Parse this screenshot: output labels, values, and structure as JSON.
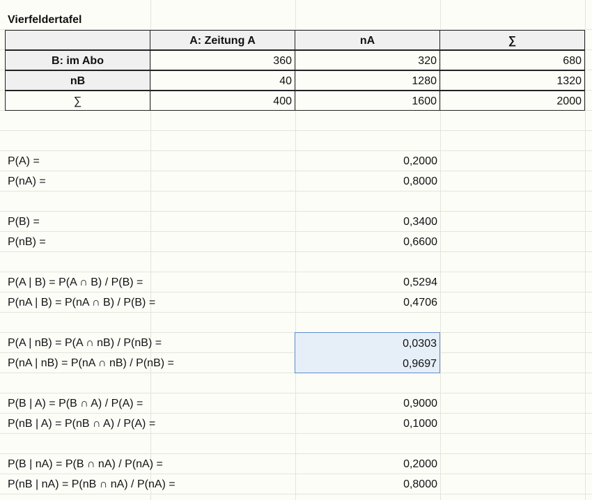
{
  "title": "Vierfeldertafel",
  "table": {
    "headers": [
      "",
      "A: Zeitung A",
      "nA",
      "∑"
    ],
    "rows": [
      {
        "label": "B: im Abo",
        "values": [
          "360",
          "320",
          "680"
        ]
      },
      {
        "label": "nB",
        "values": [
          "40",
          "1280",
          "1320"
        ]
      },
      {
        "label": "∑",
        "values": [
          "400",
          "1600",
          "2000"
        ]
      }
    ]
  },
  "probabilities": [
    {
      "label": "P(A) =",
      "value": "0,2000"
    },
    {
      "label": "P(nA) =",
      "value": "0,8000"
    },
    {
      "label": "P(B) =",
      "value": "0,3400"
    },
    {
      "label": "P(nB) =",
      "value": "0,6600"
    },
    {
      "label": "P(A | B) = P(A ∩ B) / P(B) =",
      "value": "0,5294"
    },
    {
      "label": "P(nA | B) = P(nA ∩ B) / P(B) =",
      "value": "0,4706"
    },
    {
      "label": "P(A | nB) = P(A ∩ nB) / P(nB) =",
      "value": "0,0303"
    },
    {
      "label": "P(nA | nB) = P(nA ∩ nB) / P(nB) =",
      "value": "0,9697"
    },
    {
      "label": "P(B | A) = P(B ∩ A) / P(A) =",
      "value": "0,9000"
    },
    {
      "label": "P(nB | A) = P(nB ∩ A) / P(A) =",
      "value": "0,1000"
    },
    {
      "label": "P(B | nA) = P(B ∩ nA) / P(nA) =",
      "value": "0,2000"
    },
    {
      "label": "P(nB | nA) = P(nB ∩ nA) / P(nA) =",
      "value": "0,8000"
    }
  ]
}
